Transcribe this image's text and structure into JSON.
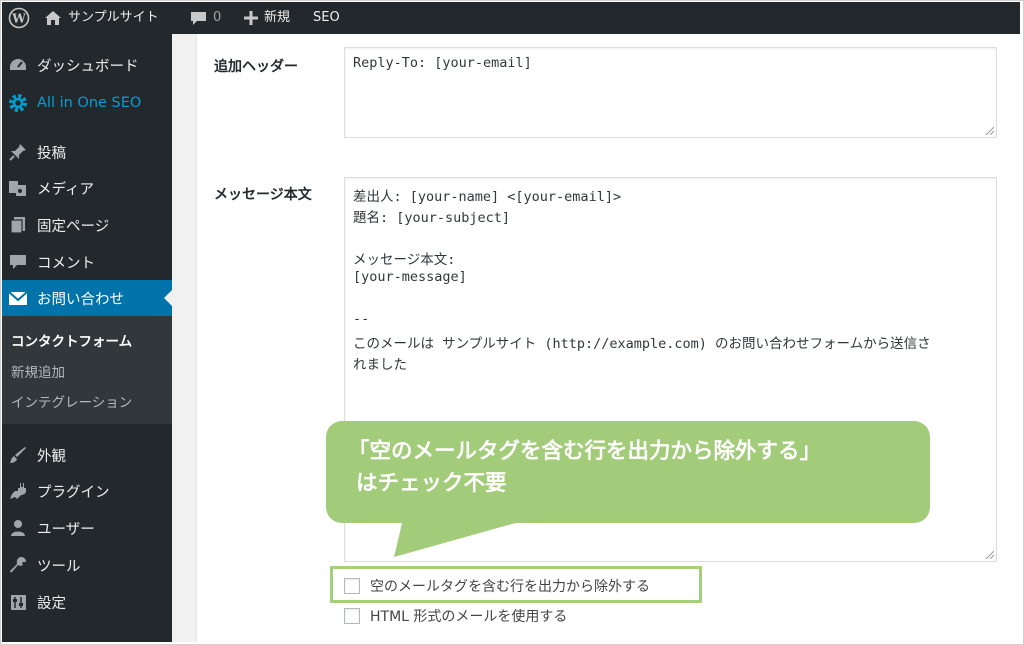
{
  "admin_bar": {
    "site_name": "サンプルサイト",
    "comment_count": "0",
    "new_label": "新規",
    "seo_label": "SEO"
  },
  "sidebar": {
    "items": [
      {
        "label": "ダッシュボード",
        "icon": "dashboard-icon"
      },
      {
        "label": "All in One SEO",
        "icon": "gear-icon"
      },
      {
        "label": "投稿",
        "icon": "pin-icon"
      },
      {
        "label": "メディア",
        "icon": "media-icon"
      },
      {
        "label": "固定ページ",
        "icon": "page-icon"
      },
      {
        "label": "コメント",
        "icon": "comment-icon"
      },
      {
        "label": "お問い合わせ",
        "icon": "mail-icon"
      },
      {
        "label": "外観",
        "icon": "brush-icon"
      },
      {
        "label": "プラグイン",
        "icon": "plugin-icon"
      },
      {
        "label": "ユーザー",
        "icon": "user-icon"
      },
      {
        "label": "ツール",
        "icon": "wrench-icon"
      },
      {
        "label": "設定",
        "icon": "settings-icon"
      }
    ],
    "submenu": [
      "コンタクトフォーム",
      "新規追加",
      "インテグレーション"
    ]
  },
  "form": {
    "additional_headers_label": "追加ヘッダー",
    "additional_headers_value": "Reply-To: [your-email]",
    "message_body_label": "メッセージ本文",
    "message_lines": [
      "差出人: [your-name] <[your-email]>",
      "題名: [your-subject]",
      "",
      "メッセージ本文:",
      "[your-message]",
      "",
      "--",
      "このメールは サンプルサイト (http://example.com) のお問い合わせフォームから送信さ",
      "れました"
    ],
    "checkbox_exclude_blank": "空のメールタグを含む行を出力から除外する",
    "checkbox_html": "HTML 形式のメールを使用する"
  },
  "callout": {
    "line1": "「空のメールタグを含む行を出力から除外する」",
    "line2": "はチェック不要"
  },
  "colors": {
    "admin_bar": "#23282d",
    "active_menu": "#0073aa",
    "aioseo": "#00a0d2",
    "callout_green": "#a3cc7a"
  }
}
